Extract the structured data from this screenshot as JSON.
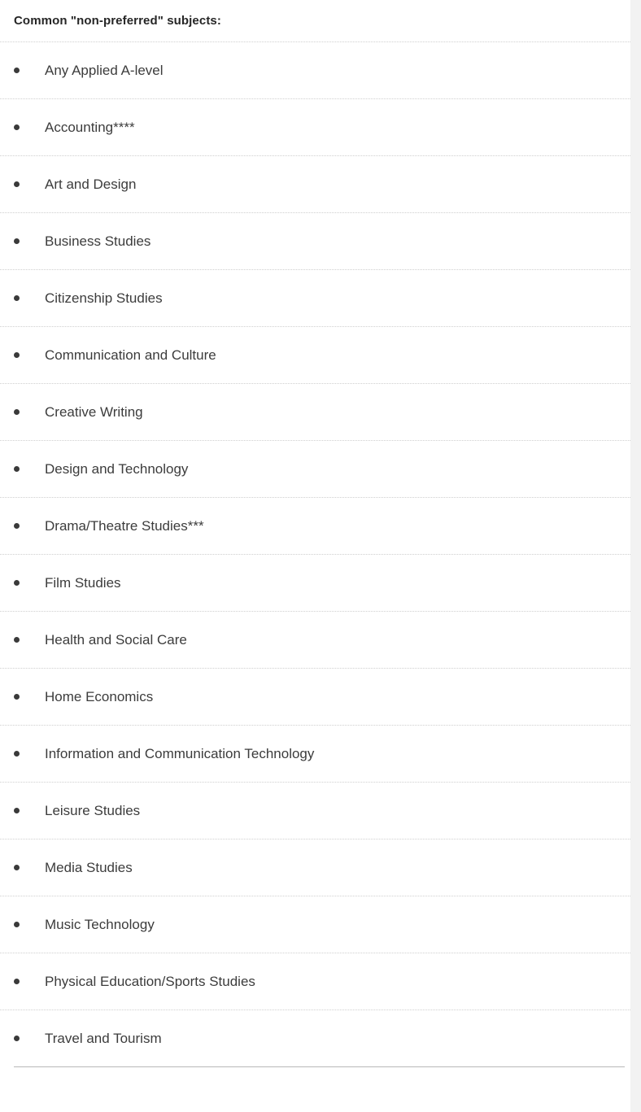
{
  "section": {
    "heading": "Common \"non-preferred\" subjects:",
    "bullet_icon": "bullet-dot-icon",
    "divider_style": "dotted",
    "end_divider_style": "solid",
    "colors": {
      "heading_text": "#262626",
      "item_text": "#3c3c3c",
      "bullet": "#3a3a3a",
      "dotted_divider": "#cfcfcf",
      "solid_divider": "#b9b9b9",
      "background": "#ffffff",
      "right_edge_band": "#f2f2f2"
    },
    "items": [
      {
        "label": "Any Applied A-level"
      },
      {
        "label": "Accounting****"
      },
      {
        "label": "Art and Design"
      },
      {
        "label": "Business Studies"
      },
      {
        "label": "Citizenship Studies"
      },
      {
        "label": "Communication and Culture"
      },
      {
        "label": "Creative Writing"
      },
      {
        "label": "Design and Technology"
      },
      {
        "label": "Drama/Theatre Studies***"
      },
      {
        "label": "Film Studies"
      },
      {
        "label": "Health and Social Care"
      },
      {
        "label": "Home Economics"
      },
      {
        "label": "Information and Communication Technology"
      },
      {
        "label": "Leisure Studies"
      },
      {
        "label": "Media Studies"
      },
      {
        "label": "Music Technology"
      },
      {
        "label": "Physical Education/Sports Studies"
      },
      {
        "label": "Travel and Tourism"
      }
    ]
  }
}
